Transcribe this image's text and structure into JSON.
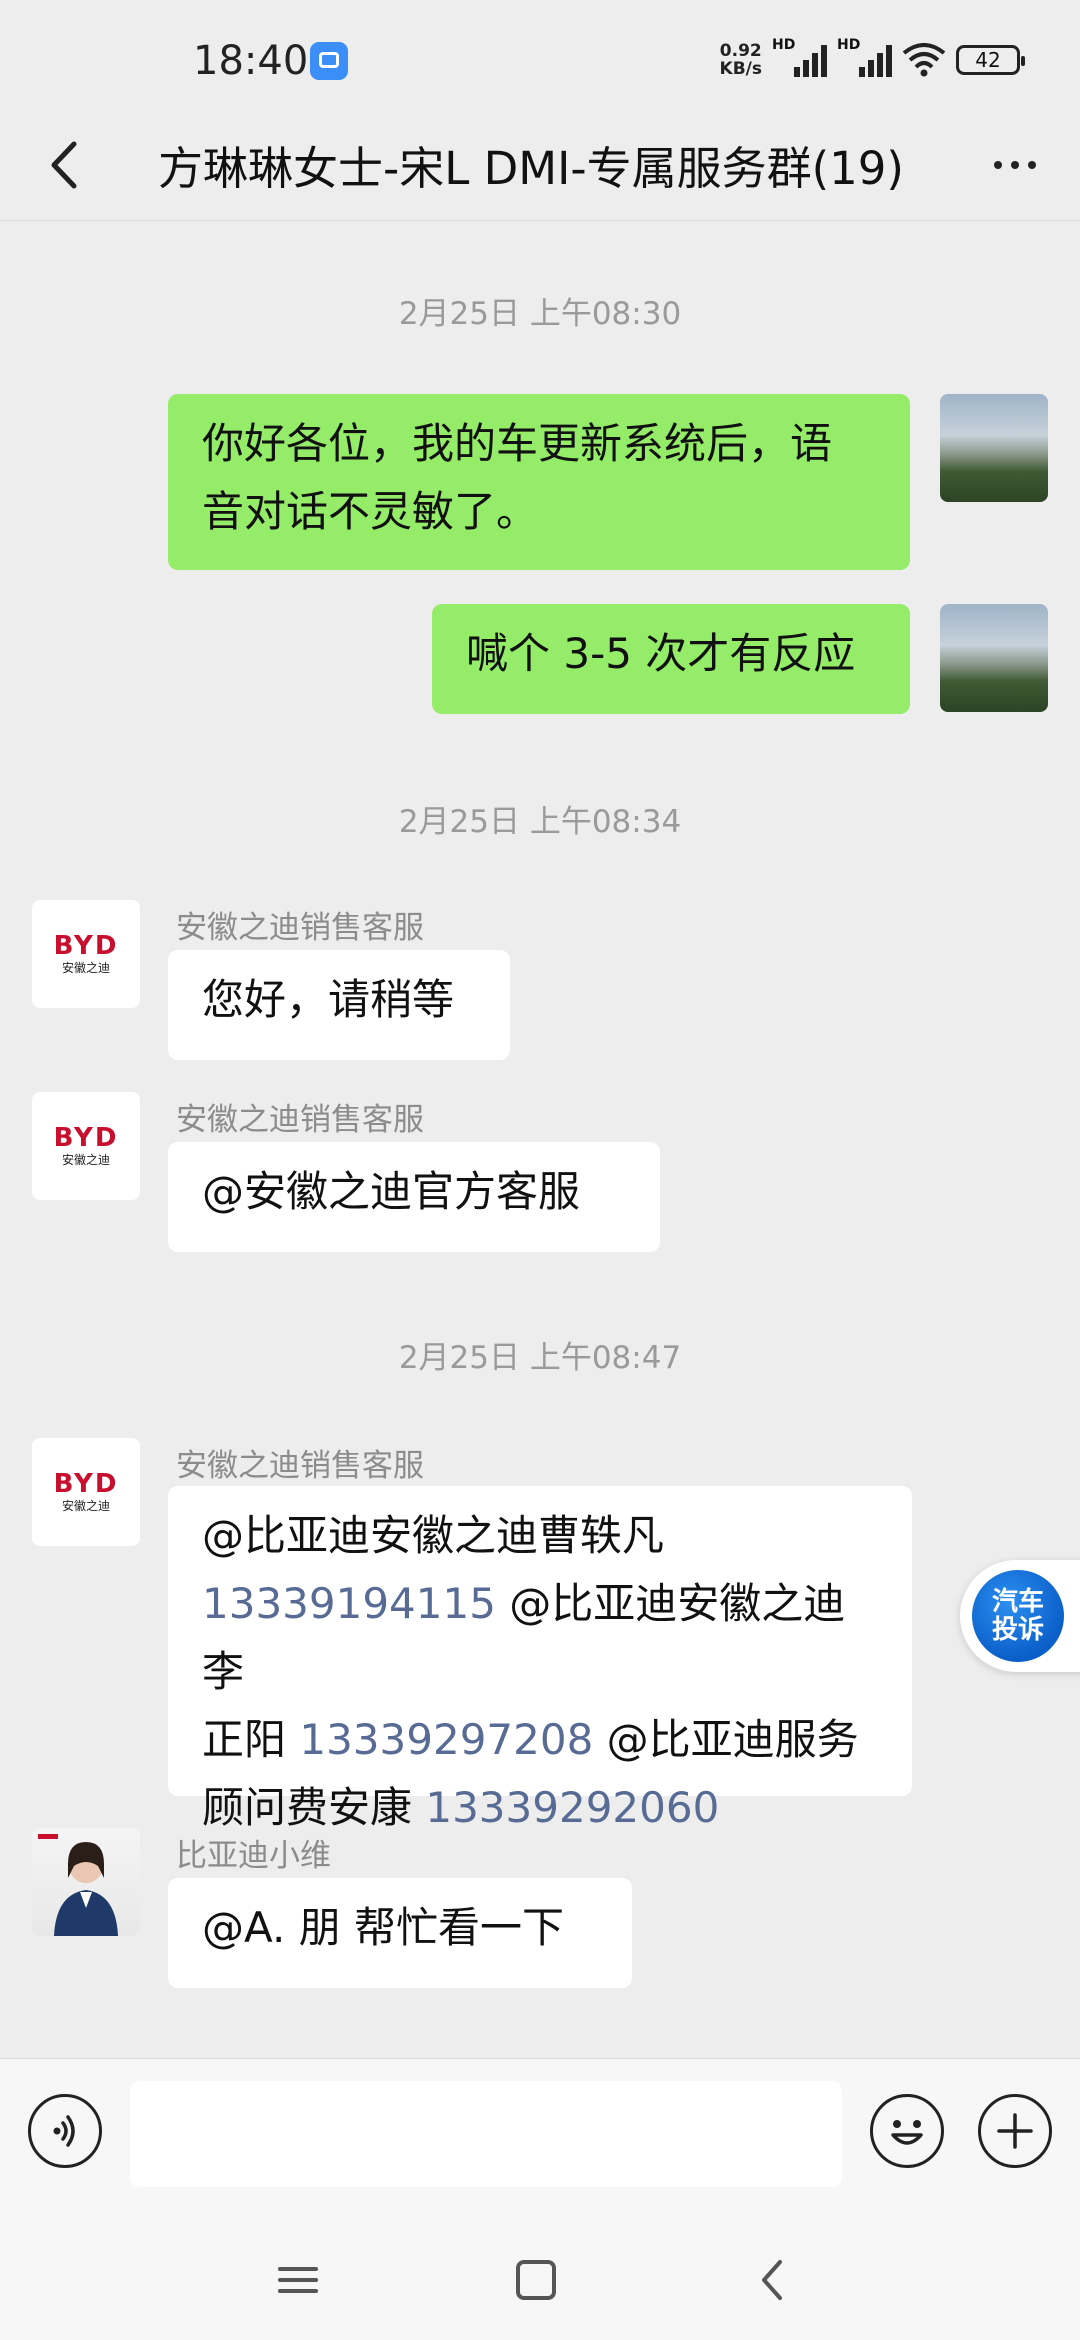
{
  "status_bar": {
    "time": "18:40",
    "net_speed_value": "0.92",
    "net_speed_unit": "KB/s",
    "signal_label_1": "HD",
    "signal_label_2": "HD",
    "battery": "42"
  },
  "header": {
    "title": "方琳琳女士-宋L DMI-专属服务群(19)",
    "back_icon": "chevron-left-icon",
    "more_icon": "more-horizontal-icon"
  },
  "timestamps": [
    "2月25日 上午08:30",
    "2月25日 上午08:34",
    "2月25日 上午08:47"
  ],
  "messages": [
    {
      "from": "self",
      "text_lines": [
        "你好各位，我的车更新系统后，语",
        "音对话不灵敏了。"
      ]
    },
    {
      "from": "self",
      "text": "喊个 3-5 次才有反应"
    },
    {
      "from": "other",
      "sender": "安徽之迪销售客服",
      "text": "您好，请稍等"
    },
    {
      "from": "other",
      "sender": "安徽之迪销售客服",
      "text": "@安徽之迪官方客服"
    },
    {
      "from": "other",
      "sender": "安徽之迪销售客服",
      "parts": {
        "a": "@比亚迪安徽之迪曹轶凡",
        "phone1": "13339194115",
        "b": " @比亚迪安徽之迪 李",
        "c": "正阳 ",
        "phone2": "13339297208",
        "d": " @比亚迪服务",
        "e": "顾问费安康 ",
        "phone3": "13339292060"
      }
    },
    {
      "from": "other",
      "sender": "比亚迪小维",
      "text": "@A. 朋  帮忙看一下"
    }
  ],
  "byd_logo": {
    "mark": "BYD",
    "sub": "安徽之迪"
  },
  "float_badge": {
    "line1": "汽车",
    "line2": "投诉"
  },
  "input_bar": {
    "voice_icon": "voice-icon",
    "emoji_icon": "emoji-icon",
    "plus_icon": "plus-icon",
    "input_value": ""
  },
  "colors": {
    "self_bubble": "#95ec69",
    "other_bubble": "#ffffff",
    "background": "#ededed",
    "link": "#576b95"
  }
}
